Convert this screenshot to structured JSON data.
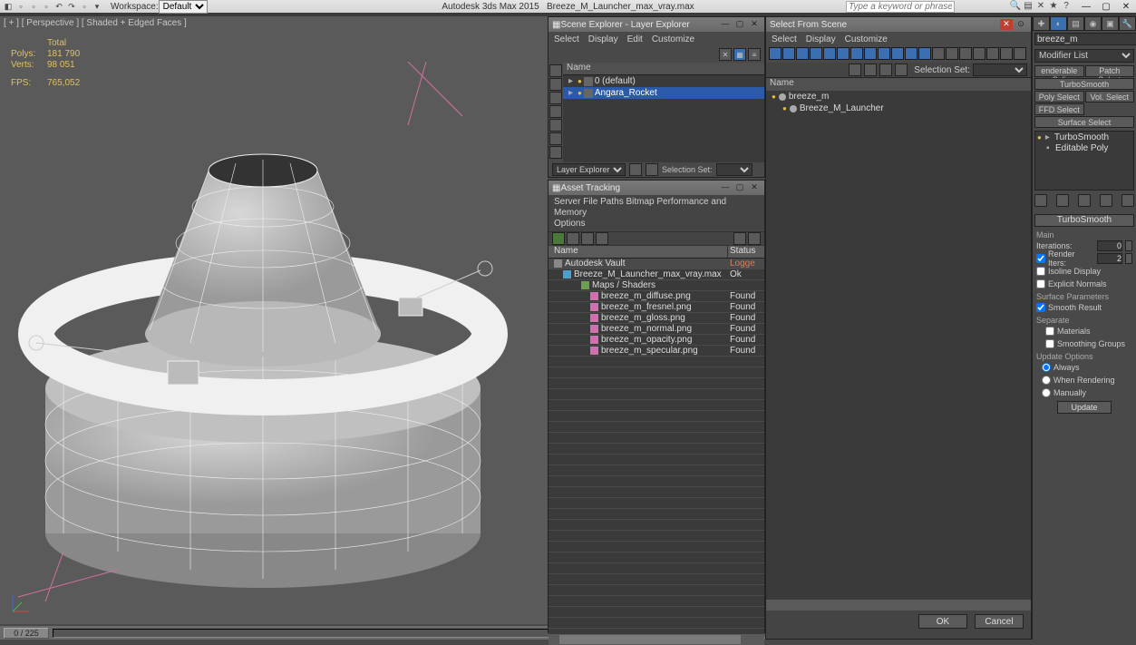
{
  "app": {
    "title_left": "Autodesk 3ds Max 2015",
    "title_file": "Breeze_M_Launcher_max_vray.max",
    "workspace_label": "Workspace:",
    "workspace_value": "Default",
    "search_placeholder": "Type a keyword or phrase"
  },
  "viewport": {
    "label": "[ + ] [ Perspective ] [ Shaded + Edged Faces ]",
    "stats": {
      "total_label": "Total",
      "polys_label": "Polys:",
      "polys": "181 790",
      "verts_label": "Verts:",
      "verts": "98 051",
      "fps_label": "FPS:",
      "fps": "765,052"
    }
  },
  "timeline": {
    "frame": "0 / 225"
  },
  "scene_explorer": {
    "title": "Scene Explorer - Layer Explorer",
    "menu": [
      "Select",
      "Display",
      "Edit",
      "Customize"
    ],
    "header": "Name",
    "rows": [
      {
        "label": "0 (default)",
        "selected": false
      },
      {
        "label": "Angara_Rocket",
        "selected": true
      }
    ],
    "footer_label": "Layer Explorer",
    "selection_set_label": "Selection Set:"
  },
  "asset_tracking": {
    "title": "Asset Tracking",
    "menu_line1": "Server   File   Paths   Bitmap Performance and Memory",
    "menu_line2": "Options",
    "columns": {
      "name": "Name",
      "status": "Status"
    },
    "rows": [
      {
        "name": "Autodesk Vault",
        "status": "Logge",
        "type": "vault",
        "indent": 0
      },
      {
        "name": "Breeze_M_Launcher_max_vray.max",
        "status": "Ok",
        "type": "max",
        "indent": 1
      },
      {
        "name": "Maps / Shaders",
        "status": "",
        "type": "folder",
        "indent": 2
      },
      {
        "name": "breeze_m_diffuse.png",
        "status": "Found",
        "type": "png",
        "indent": 3
      },
      {
        "name": "breeze_m_fresnel.png",
        "status": "Found",
        "type": "png",
        "indent": 3
      },
      {
        "name": "breeze_m_gloss.png",
        "status": "Found",
        "type": "png",
        "indent": 3
      },
      {
        "name": "breeze_m_normal.png",
        "status": "Found",
        "type": "png",
        "indent": 3
      },
      {
        "name": "breeze_m_opacity.png",
        "status": "Found",
        "type": "png",
        "indent": 3
      },
      {
        "name": "breeze_m_specular.png",
        "status": "Found",
        "type": "png",
        "indent": 3
      }
    ]
  },
  "select_from": {
    "title": "Select From Scene",
    "menu": [
      "Select",
      "Display",
      "Customize"
    ],
    "selection_set_label": "Selection Set:",
    "header": "Name",
    "rows": [
      {
        "label": "breeze_m"
      },
      {
        "label": "Breeze_M_Launcher"
      }
    ],
    "ok": "OK",
    "cancel": "Cancel"
  },
  "cmd_panel": {
    "object_name": "breeze_m",
    "modifier_list_label": "Modifier List",
    "mod_buttons": [
      "enderable Spli",
      "Patch Select",
      "TurboSmooth",
      "Poly Select",
      "Vol. Select",
      "FFD Select",
      "",
      "Surface Select"
    ],
    "stack": [
      {
        "label": "TurboSmooth",
        "bulb": true
      },
      {
        "label": "Editable Poly",
        "bulb": false,
        "sel": true
      }
    ],
    "rollout_title": "TurboSmooth",
    "main_label": "Main",
    "iterations_label": "Iterations:",
    "iterations": "0",
    "render_iters_label": "Render Iters:",
    "render_iters_checked": true,
    "render_iters": "2",
    "isoline_label": "Isoline Display",
    "explicit_label": "Explicit Normals",
    "surface_params_label": "Surface Parameters",
    "smooth_result_label": "Smooth Result",
    "smooth_result_checked": true,
    "separate_label": "Separate",
    "materials_label": "Materials",
    "smoothing_groups_label": "Smoothing Groups",
    "update_options_label": "Update Options",
    "always_label": "Always",
    "when_rendering_label": "When Rendering",
    "manually_label": "Manually",
    "update_btn": "Update"
  }
}
